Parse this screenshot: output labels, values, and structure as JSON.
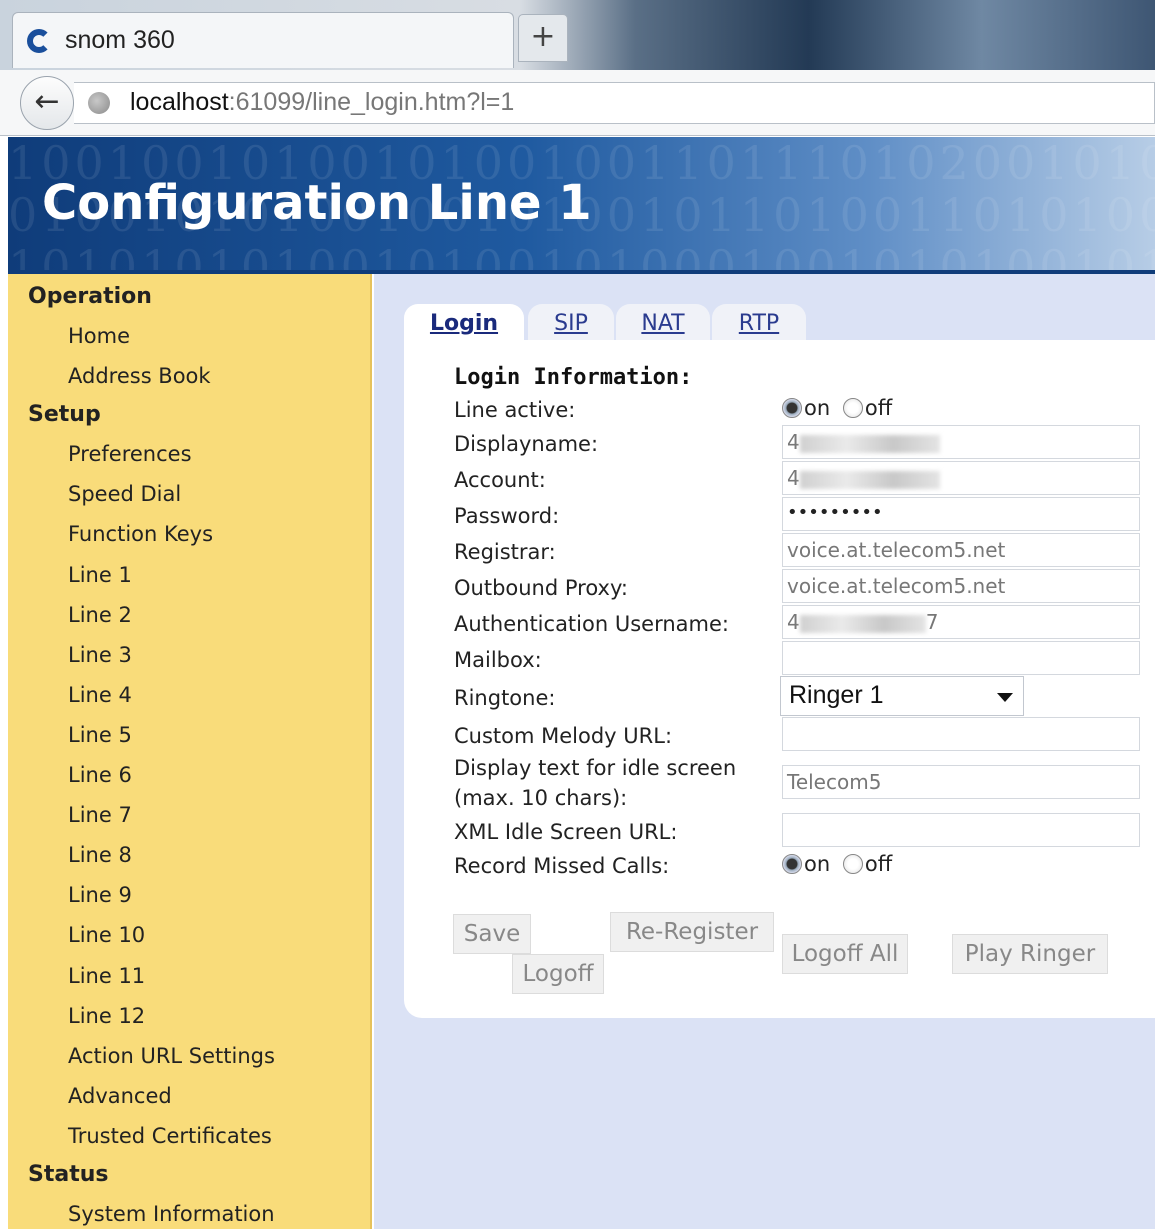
{
  "browser": {
    "tab_title": "snom 360",
    "new_tab_label": "+",
    "back_label": "←",
    "url_host": "localhost",
    "url_rest": ":61099/line_login.htm?l=1"
  },
  "header": {
    "title": "Configuration Line 1",
    "binary_rows": [
      "100100101001010010011011101020010100101",
      "010010101001001010010110100110101001010",
      "101010101001010010100010010101001010010"
    ]
  },
  "sidebar": {
    "sections": [
      {
        "title": "Operation",
        "items": [
          "Home",
          "Address Book"
        ]
      },
      {
        "title": "Setup",
        "items": [
          "Preferences",
          "Speed Dial",
          "Function Keys",
          "Line 1",
          "Line 2",
          "Line 3",
          "Line 4",
          "Line 5",
          "Line 6",
          "Line 7",
          "Line 8",
          "Line 9",
          "Line 10",
          "Line 11",
          "Line 12",
          "Action URL Settings",
          "Advanced",
          "Trusted Certificates"
        ]
      },
      {
        "title": "Status",
        "items": [
          "System Information"
        ]
      }
    ]
  },
  "tabs": [
    "Login",
    "SIP",
    "NAT",
    "RTP"
  ],
  "active_tab": "Login",
  "form": {
    "section_title": "Login Information:",
    "line_active_label": "Line active:",
    "on_label": "on",
    "off_label": "off",
    "line_active_value": "on",
    "displayname_label": "Displayname:",
    "displayname_value": "4",
    "account_label": "Account:",
    "account_value": "4",
    "password_label": "Password:",
    "password_value": "•••••••••",
    "registrar_label": "Registrar:",
    "registrar_value": "voice.at.telecom5.net",
    "outbound_proxy_label": "Outbound Proxy:",
    "outbound_proxy_value": "voice.at.telecom5.net",
    "auth_username_label": "Authentication Username:",
    "auth_username_prefix": "4",
    "auth_username_suffix": "7",
    "mailbox_label": "Mailbox:",
    "mailbox_value": "",
    "ringtone_label": "Ringtone:",
    "ringtone_value": "Ringer 1",
    "custom_melody_label": "Custom Melody URL:",
    "custom_melody_value": "",
    "idle_text_label_1": "Display text for idle screen",
    "idle_text_label_2": "(max. 10 chars):",
    "idle_text_value": "Telecom5",
    "xml_idle_label": "XML Idle Screen URL:",
    "xml_idle_value": "",
    "record_missed_label": "Record Missed Calls:",
    "record_missed_value": "on"
  },
  "buttons": {
    "save": "Save",
    "reregister": "Re-Register",
    "logoff": "Logoff",
    "logoff_all": "Logoff All",
    "play_ringer": "Play Ringer"
  }
}
